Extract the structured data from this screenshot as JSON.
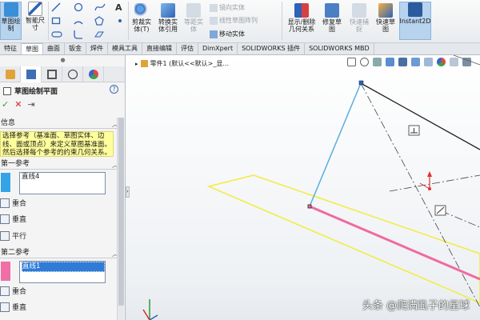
{
  "ribbon": {
    "exit_sketch": "草图绘\n制",
    "smart_dim": "智能尺\n寸",
    "trim": "剪裁实\n体(T)",
    "convert": "转换实\n体引用",
    "offset": "等距实\n体",
    "mirror": "镜向实体",
    "linear_pattern": "线性草图阵列",
    "move": "移动实体",
    "display_relations": "显示/删除\n几何关系",
    "repair": "修复草\n图",
    "quick_snaps": "快速捕\n捉",
    "rapid_sketch": "快速草\n图",
    "instant2d": "Instant2D"
  },
  "tabs": [
    "特征",
    "草图",
    "曲面",
    "钣金",
    "焊件",
    "模具工具",
    "直接编辑",
    "评估",
    "DimXpert",
    "SOLIDWORKS 插件",
    "SOLIDWORKS MBD"
  ],
  "active_tab": 1,
  "panel": {
    "title": "草图绘制平面",
    "help": "?",
    "ok": "✓",
    "cancel": "✕",
    "pin": "⇥",
    "message_header": "信息",
    "message": "选择参考（基准面、草图实体、边线、面或顶点）来定义草图基准面。然后选择每个参考的约束几何关系。",
    "first_ref_header": "第一参考",
    "first_ref_value": "直线4",
    "first_relations": [
      "重合",
      "垂直",
      "平行"
    ],
    "second_ref_header": "第二参考",
    "second_ref_value": "直线1",
    "second_relations": [
      "重合",
      "垂直"
    ]
  },
  "canvas": {
    "tree_label": "零件1  (默认<<默认>_显...",
    "watermark": "头条 @爬满虱子的星球"
  },
  "colors": {
    "accent_blue": "#2f7bd6",
    "sketch_yellow": "#f2ec3a",
    "sketch_pink": "#f06aa0",
    "sketch_blue": "#5aaee0",
    "message_bg": "#fffe9c"
  }
}
